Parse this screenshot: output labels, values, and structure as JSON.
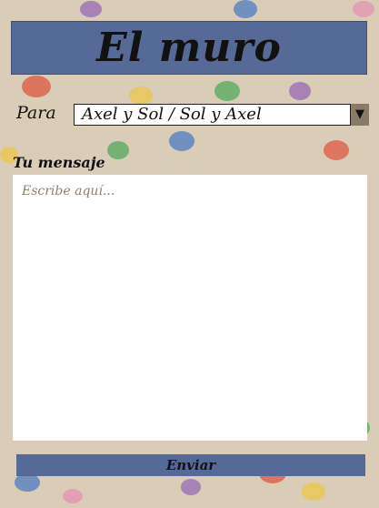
{
  "header": {
    "title": "El muro"
  },
  "recipient": {
    "label": "Para",
    "selected": "Axel y Sol / Sol y Axel",
    "arrow_icon": "caret-down-icon"
  },
  "message": {
    "label": "Tu mensaje",
    "placeholder": "Escribe aquí..."
  },
  "send_label": "Enviar",
  "colors": {
    "header_bg": "#566a98",
    "wall_bg": "#d9cdb8",
    "dropdown_arrow_bg": "#8a7a66",
    "placeholder": "#8f7f6a"
  }
}
